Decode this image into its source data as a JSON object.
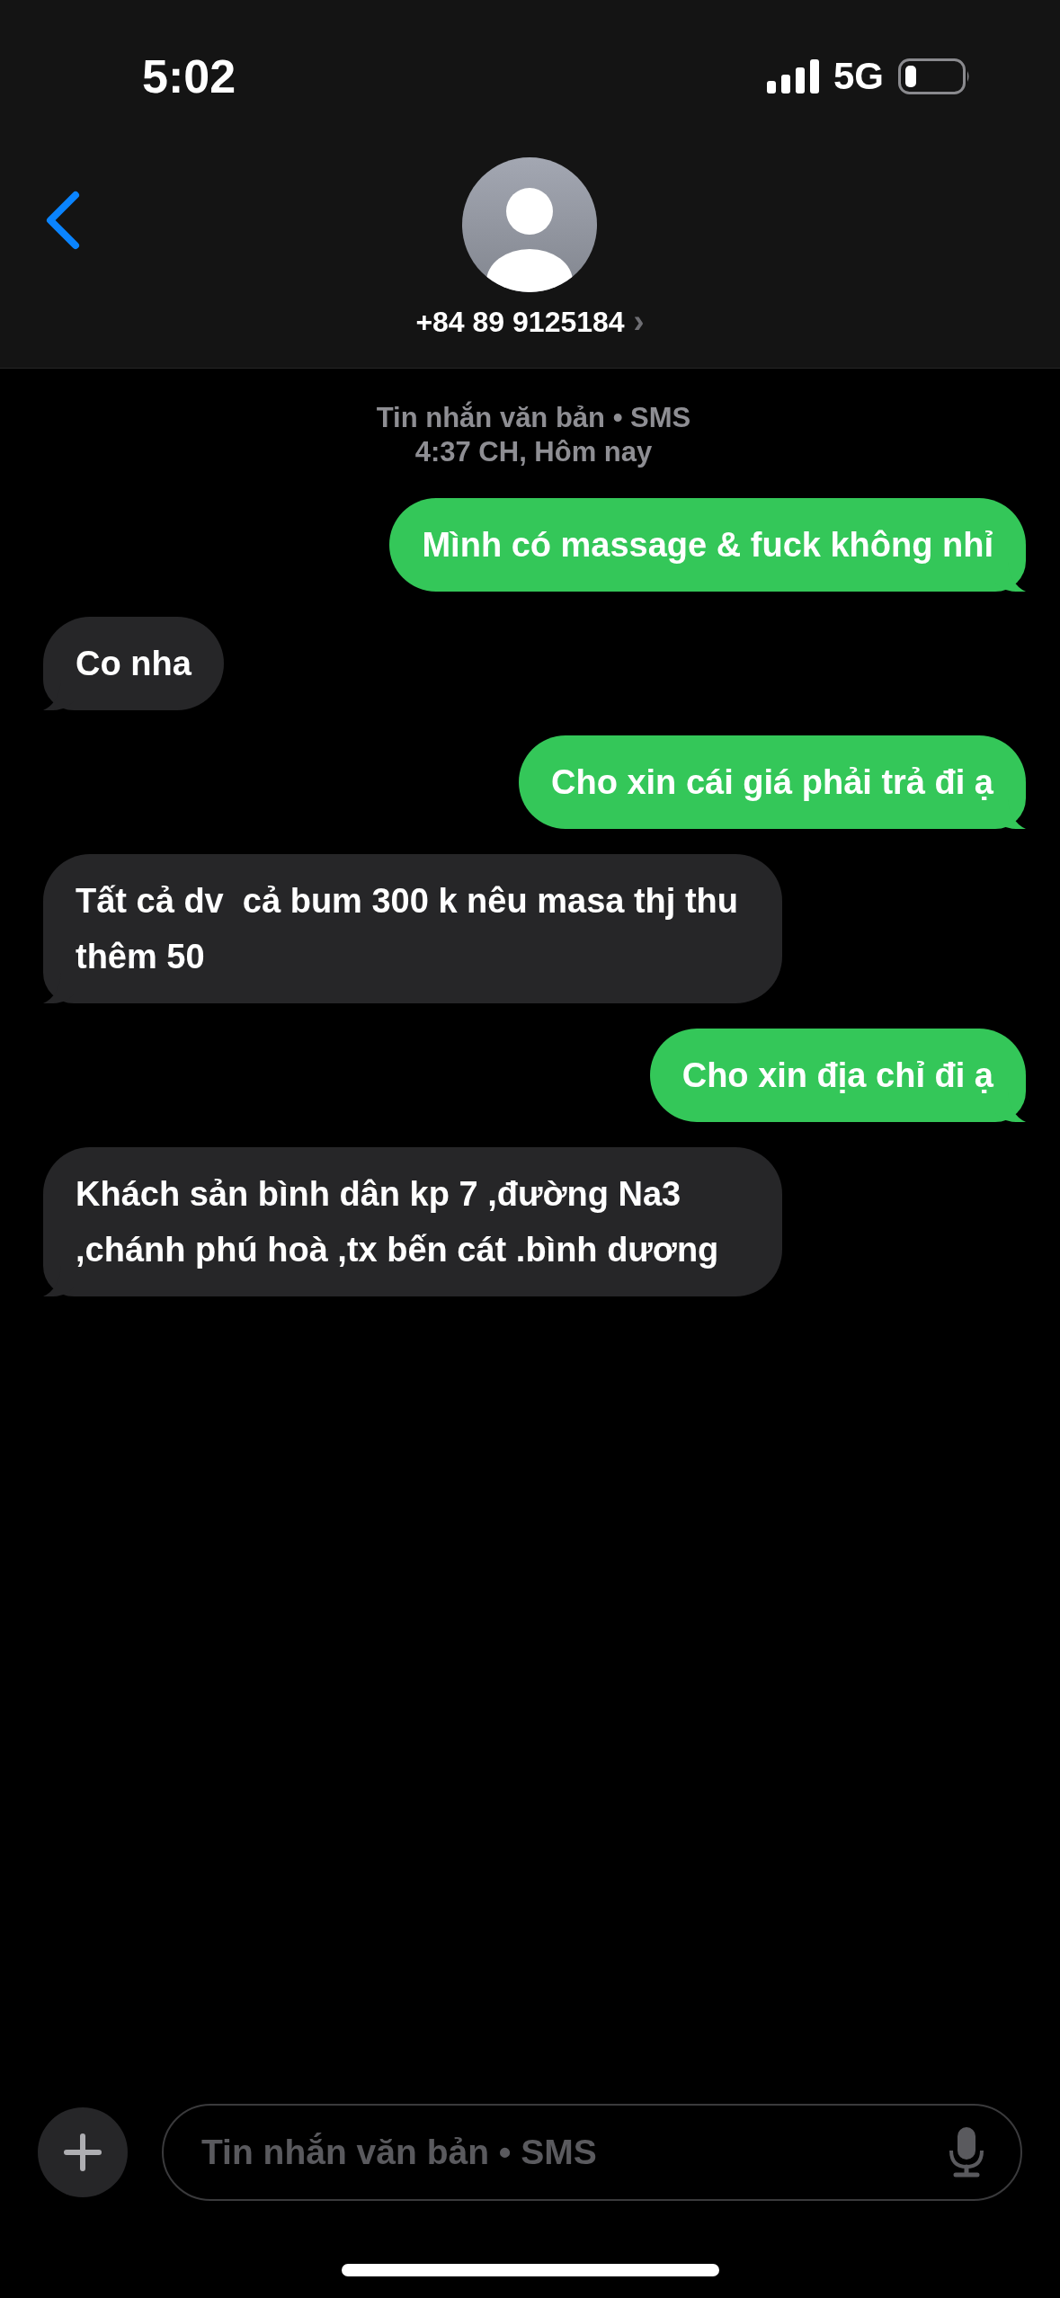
{
  "status_bar": {
    "time": "5:02",
    "network": "5G"
  },
  "contact": {
    "name": "+84 89 9125184",
    "chevron": "›"
  },
  "conversation": {
    "service": "Tin nhắn văn bản • SMS",
    "timestamp": "4:37 CH, Hôm nay"
  },
  "messages": [
    {
      "kind": "sent",
      "text": "Mình có massage & fuck không nhỉ"
    },
    {
      "kind": "received",
      "text": "Co nha"
    },
    {
      "kind": "sent",
      "text": "Cho xin cái giá phải trả đi ạ"
    },
    {
      "kind": "received",
      "text": "Tất cả dv  cả bum 300 k nêu masa thj thu thêm 50"
    },
    {
      "kind": "sent",
      "text": "Cho xin địa chỉ đi ạ"
    },
    {
      "kind": "received",
      "text": "Khách sản bình dân kp 7 ,đường Na3 ,chánh phú hoà ,tx bến cát .bình dương"
    }
  ],
  "composer": {
    "placeholder": "Tin nhắn văn bản • SMS"
  }
}
